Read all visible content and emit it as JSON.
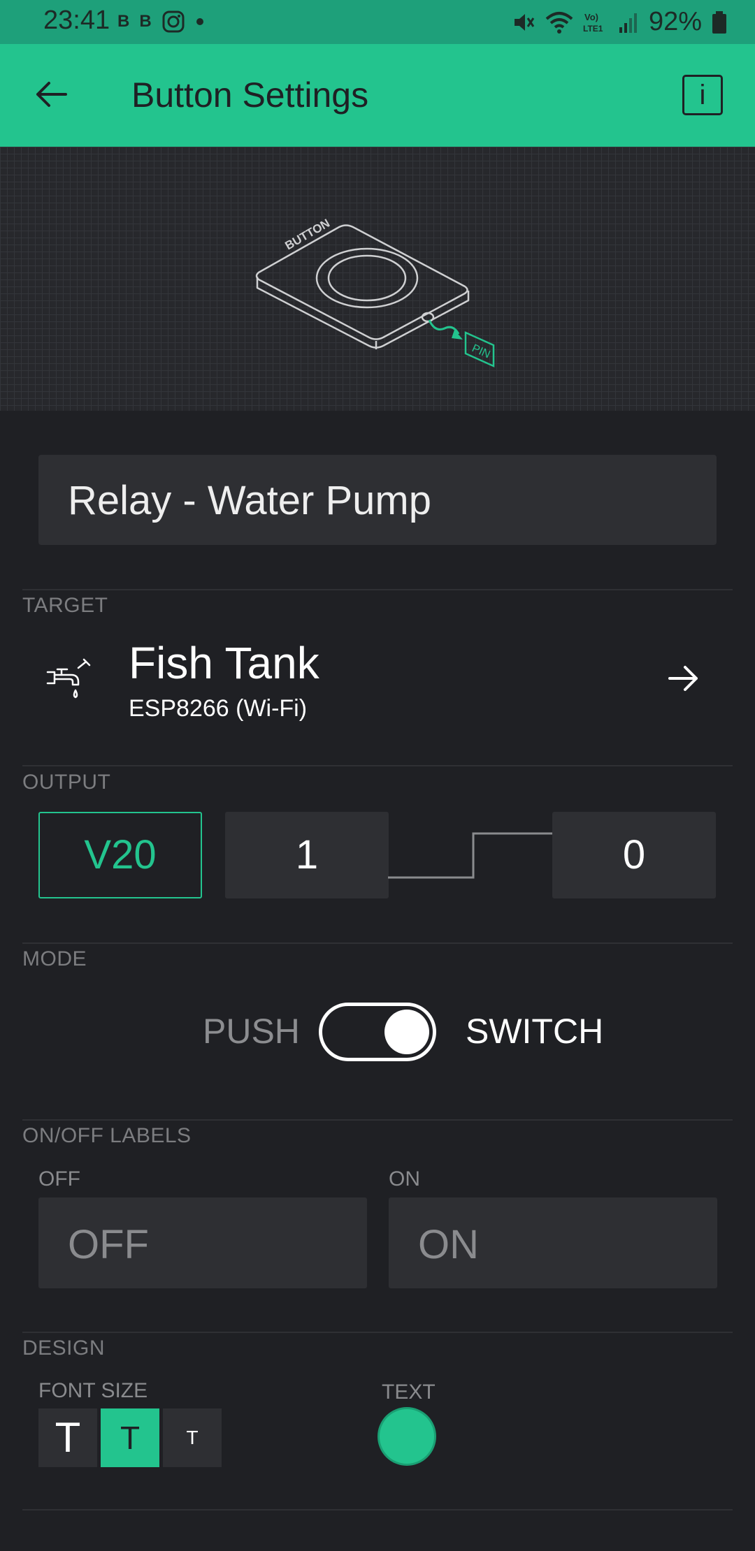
{
  "status_bar": {
    "time": "23:41",
    "notification_icons": [
      "B",
      "B"
    ],
    "battery_percent": "92%"
  },
  "app_bar": {
    "title": "Button Settings",
    "info_label": "i"
  },
  "illustration": {
    "button_text": "BUTTON",
    "pin_text": "PIN"
  },
  "widget_name": "Relay - Water Pump",
  "target": {
    "section_label": "TARGET",
    "name": "Fish Tank",
    "device": "ESP8266 (Wi-Fi)"
  },
  "output": {
    "section_label": "OUTPUT",
    "pin": "V20",
    "low_value": "1",
    "high_value": "0"
  },
  "mode": {
    "section_label": "MODE",
    "option_push": "PUSH",
    "option_switch": "SWITCH",
    "selected": "SWITCH"
  },
  "labels": {
    "section_label": "ON/OFF LABELS",
    "off_label": "OFF",
    "off_placeholder": "OFF",
    "on_label": "ON",
    "on_placeholder": "ON"
  },
  "design": {
    "section_label": "DESIGN",
    "font_size_label": "FONT SIZE",
    "font_sizes": [
      "T",
      "T",
      "T"
    ],
    "selected_font_size": 1,
    "text_color_label": "TEXT",
    "text_color": "#23c48e"
  },
  "colors": {
    "accent": "#23c48e",
    "background": "#1f2024",
    "field": "#2e2f33"
  }
}
